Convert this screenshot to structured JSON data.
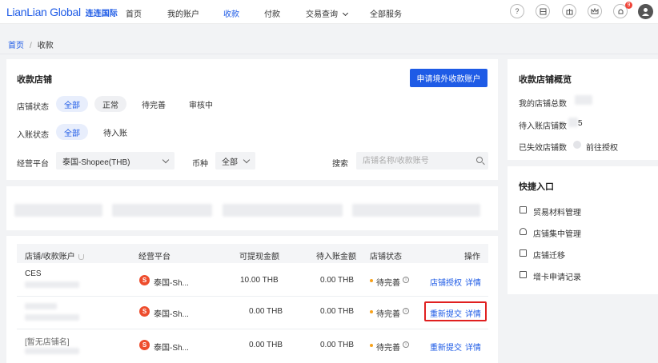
{
  "header": {
    "logo_en": "LianLian Global",
    "logo_cn": "连连国际",
    "nav": [
      "首页",
      "我的账户",
      "收款",
      "付款",
      "交易查询",
      "全部服务"
    ],
    "notification_count": "9"
  },
  "breadcrumb": {
    "home": "首页",
    "sep": "/",
    "current": "收款"
  },
  "stores": {
    "title": "收款店铺",
    "apply_button": "申请境外收款账户",
    "status_label": "店铺状态",
    "status_options": [
      "全部",
      "正常",
      "待完善",
      "审核中"
    ],
    "credit_label": "入账状态",
    "credit_options": [
      "全部",
      "待入账"
    ],
    "platform_label": "经营平台",
    "platform_value": "泰国-Shopee(THB)",
    "currency_label": "币种",
    "currency_value": "全部",
    "search_label": "搜索",
    "search_placeholder": "店铺名称/收款账号"
  },
  "table": {
    "headers": [
      "店铺/收款账户",
      "经营平台",
      "可提现金额",
      "待入账金额",
      "店铺状态",
      "操作"
    ],
    "rows": [
      {
        "name": "CES",
        "platform": "泰国-Sh...",
        "withdrawable": "10.00 THB",
        "pending": "0.00 THB",
        "status": "待完善",
        "actions": [
          "店铺授权",
          "详情"
        ]
      },
      {
        "name": "",
        "platform": "泰国-Sh...",
        "withdrawable": "0.00 THB",
        "pending": "0.00 THB",
        "status": "待完善",
        "actions": [
          "重新提交",
          "详情"
        ]
      },
      {
        "name": "[暂无店铺名]",
        "platform": "泰国-Sh...",
        "withdrawable": "0.00 THB",
        "pending": "0.00 THB",
        "status": "待完善",
        "actions": [
          "重新提交",
          "详情"
        ]
      }
    ]
  },
  "overview": {
    "title": "收款店铺概览",
    "total_label": "我的店铺总数",
    "pending_label": "待入账店铺数",
    "pending_value": "5",
    "expired_label": "已失效店铺数",
    "authorize_link": "前往授权"
  },
  "quick": {
    "title": "快捷入口",
    "items": [
      "贸易材料管理",
      "店铺集中管理",
      "店铺迁移",
      "增卡申请记录"
    ]
  },
  "colors": {
    "primary": "#1e5be6",
    "warning": "#f7a21b",
    "highlight": "#e02020",
    "shopee": "#ee4d2d"
  }
}
